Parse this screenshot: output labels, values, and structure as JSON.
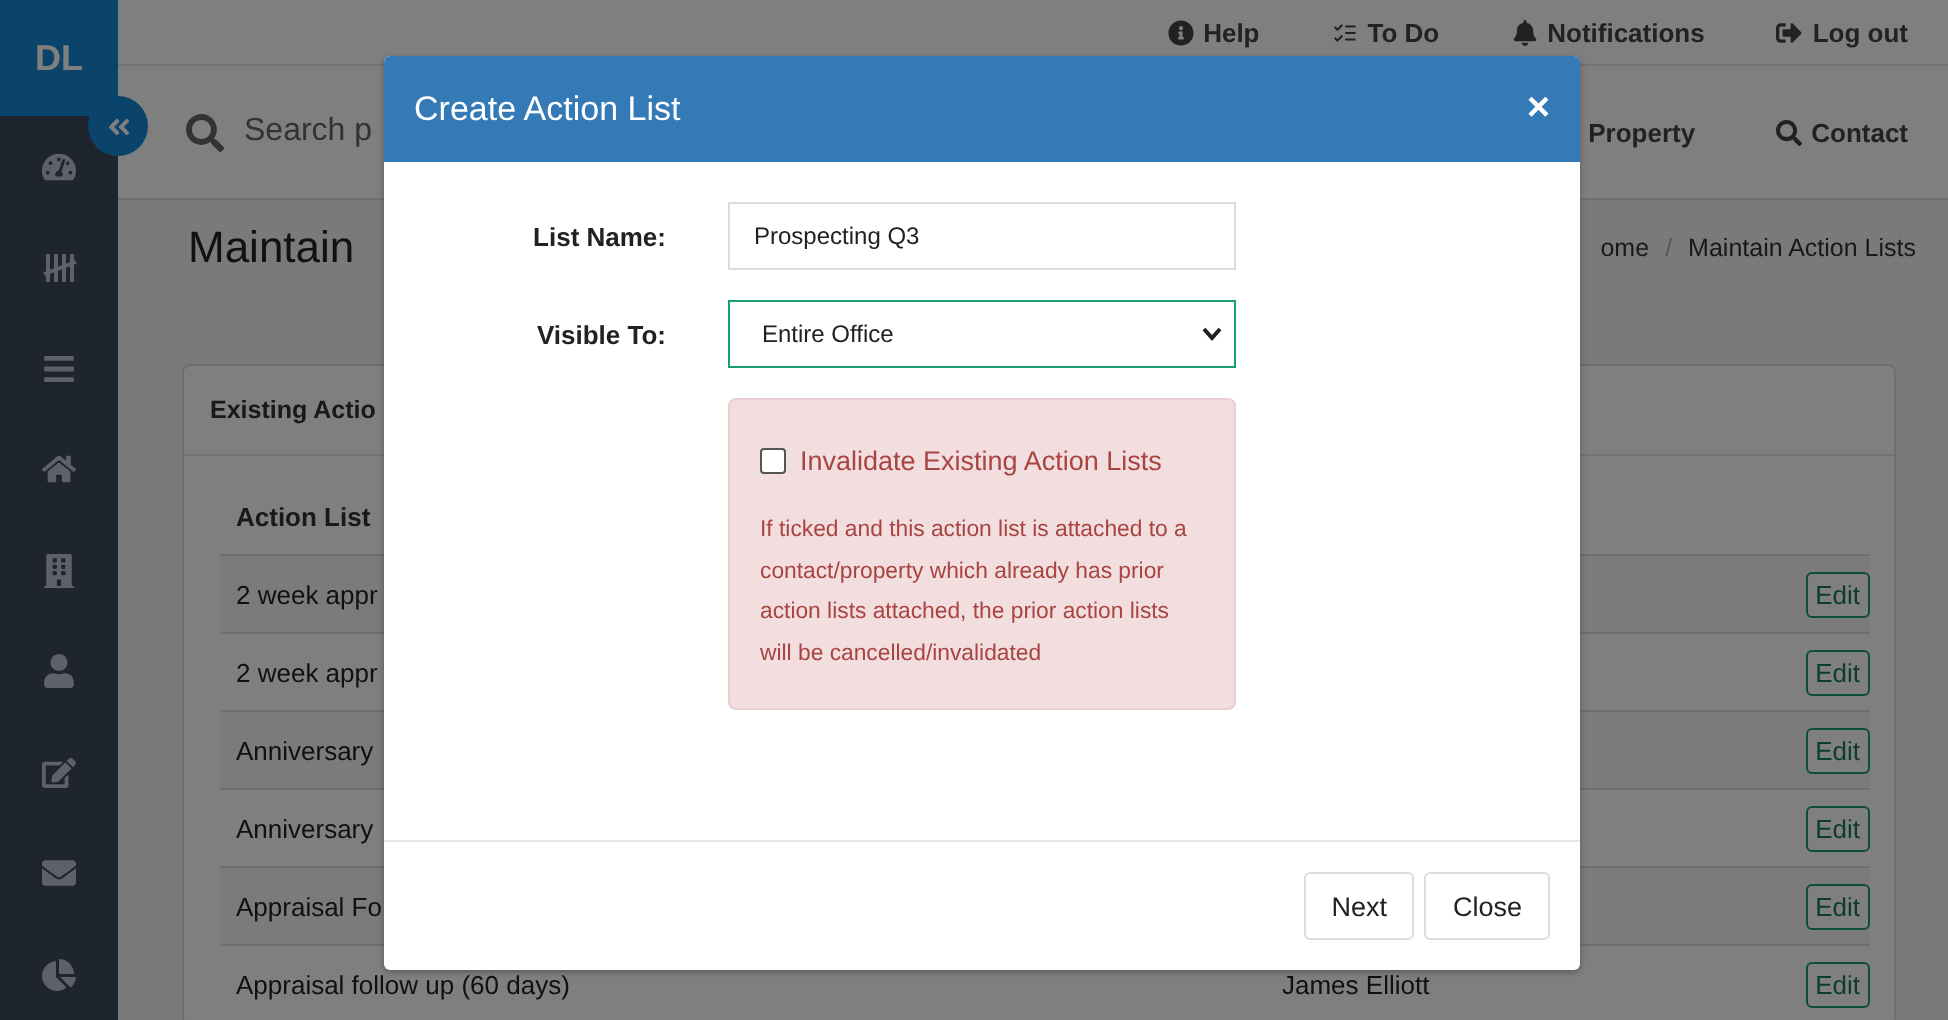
{
  "sidebar": {
    "logo": "DL"
  },
  "top_links": [
    {
      "label": "Help"
    },
    {
      "label": "To Do"
    },
    {
      "label": "Notifications"
    },
    {
      "label": "Log out"
    }
  ],
  "search": {
    "placeholder": "Search p"
  },
  "quick_links": [
    {
      "label": "Property"
    },
    {
      "label": "Contact"
    }
  ],
  "page_title": "Maintain",
  "breadcrumb": [
    "ome",
    "Maintain Action Lists"
  ],
  "breadcrumb_separator": "/",
  "card": {
    "title": "Existing Actio",
    "columns": [
      "Action List"
    ],
    "rows": [
      {
        "name": "2 week appr",
        "action": "Edit"
      },
      {
        "name": "2 week appr",
        "action": "Edit"
      },
      {
        "name": "Anniversary",
        "action": "Edit"
      },
      {
        "name": "Anniversary",
        "action": "Edit"
      },
      {
        "name": "Appraisal Fo",
        "action": "Edit"
      },
      {
        "name": "Appraisal follow up (60 days)",
        "owner": "James Elliott",
        "action": "Edit"
      }
    ]
  },
  "modal": {
    "title": "Create Action List",
    "close": "×",
    "list_name": {
      "label": "List Name:",
      "value": "Prospecting Q3"
    },
    "visible_to": {
      "label": "Visible To:",
      "value": "Entire Office"
    },
    "warning": {
      "checkbox_label": "Invalidate Existing Action Lists",
      "checked": false,
      "text": "If ticked and this action list is attached to a contact/property which already has prior action lists attached, the prior action lists will be cancelled/invalidated"
    },
    "buttons": [
      "Next",
      "Close"
    ]
  }
}
